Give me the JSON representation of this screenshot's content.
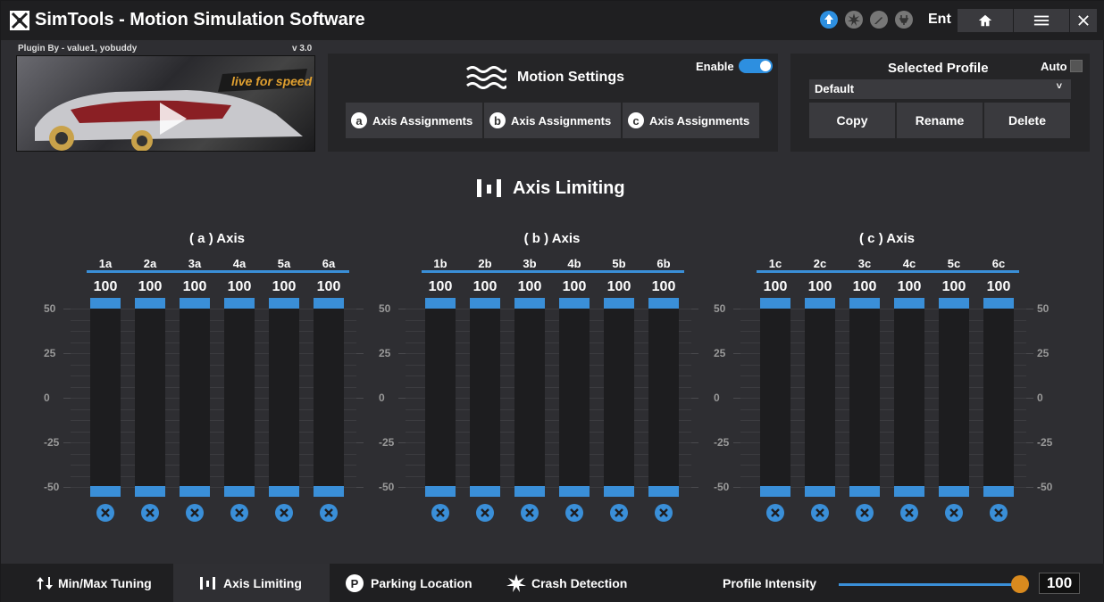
{
  "app": {
    "title": "SimTools - Motion Simulation Software",
    "ent": "Ent"
  },
  "plugin": {
    "by": "Plugin By - value1, yobuddy",
    "version": "v 3.0",
    "logo_text": "live for speed"
  },
  "motion": {
    "title": "Motion Settings",
    "enable_label": "Enable",
    "enabled": true,
    "axis_buttons": [
      {
        "badge": "a",
        "label": "Axis Assignments"
      },
      {
        "badge": "b",
        "label": "Axis Assignments"
      },
      {
        "badge": "c",
        "label": "Axis Assignments"
      }
    ]
  },
  "profile": {
    "title": "Selected Profile",
    "auto_label": "Auto",
    "selected": "Default",
    "buttons": [
      "Copy",
      "Rename",
      "Delete"
    ]
  },
  "section_title": "Axis Limiting",
  "ticks": [
    "50",
    "25",
    "0",
    "-25",
    "-50"
  ],
  "groups": [
    {
      "title": "( a ) Axis",
      "channels": [
        {
          "label": "1a",
          "value": "100"
        },
        {
          "label": "2a",
          "value": "100"
        },
        {
          "label": "3a",
          "value": "100"
        },
        {
          "label": "4a",
          "value": "100"
        },
        {
          "label": "5a",
          "value": "100"
        },
        {
          "label": "6a",
          "value": "100"
        }
      ]
    },
    {
      "title": "( b ) Axis",
      "channels": [
        {
          "label": "1b",
          "value": "100"
        },
        {
          "label": "2b",
          "value": "100"
        },
        {
          "label": "3b",
          "value": "100"
        },
        {
          "label": "4b",
          "value": "100"
        },
        {
          "label": "5b",
          "value": "100"
        },
        {
          "label": "6b",
          "value": "100"
        }
      ]
    },
    {
      "title": "( c ) Axis",
      "channels": [
        {
          "label": "1c",
          "value": "100"
        },
        {
          "label": "2c",
          "value": "100"
        },
        {
          "label": "3c",
          "value": "100"
        },
        {
          "label": "4c",
          "value": "100"
        },
        {
          "label": "5c",
          "value": "100"
        },
        {
          "label": "6c",
          "value": "100"
        }
      ]
    }
  ],
  "tabs": [
    {
      "label": "Min/Max Tuning",
      "icon": "up-down-arrows-icon",
      "active": false
    },
    {
      "label": "Axis Limiting",
      "icon": "bars-icon",
      "active": true
    },
    {
      "label": "Parking Location",
      "icon": "parking-icon",
      "active": false
    },
    {
      "label": "Crash Detection",
      "icon": "crash-icon",
      "active": false
    }
  ],
  "intensity": {
    "label": "Profile Intensity",
    "value": "100"
  },
  "colors": {
    "accent": "#3a8fd8",
    "knob": "#d98a1e",
    "background": "#2e2e32"
  }
}
